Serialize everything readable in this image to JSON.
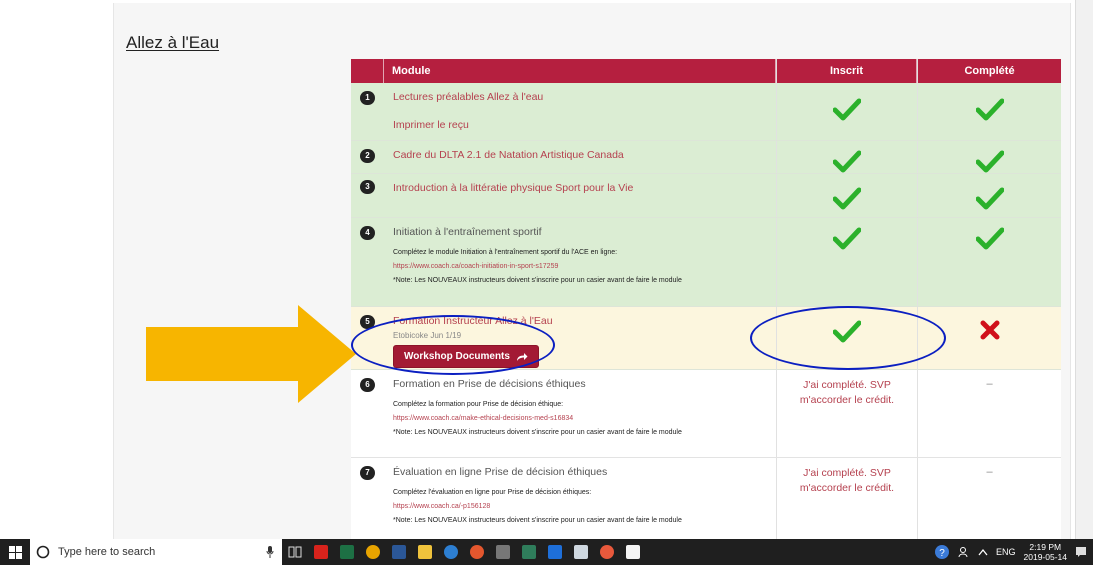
{
  "page": {
    "title": "Allez à l'Eau"
  },
  "table": {
    "headers": {
      "module": "Module",
      "enrolled": "Inscrit",
      "completed": "Complété"
    },
    "rows": [
      {
        "num": "1",
        "title": "Lectures préalables Allez à l'eau",
        "extra_link": "Imprimer le reçu",
        "enrolled": "check",
        "completed": "check"
      },
      {
        "num": "2",
        "title": "Cadre du DLTA 2.1 de Natation Artistique Canada",
        "enrolled": "check",
        "completed": "check"
      },
      {
        "num": "3",
        "title": "Introduction à la littératie physique Sport pour la Vie",
        "enrolled": "check",
        "completed": "check"
      },
      {
        "num": "4",
        "title": "Initiation à l'entraînement sportif",
        "note_intro": "Complétez le module Initiation à l'entraînement sportif du l'ACE en ligne:",
        "note_link": "https://www.coach.ca/coach-initiation-in-sport-s17259",
        "note_warn": "*Note: Les NOUVEAUX instructeurs doivent s'inscrire pour un casier avant de faire le module",
        "enrolled": "check",
        "completed": "check"
      },
      {
        "num": "5",
        "title": "Formation Instructeur Allez à l'Eau",
        "subtitle": "Etobicoke Jun 1/19",
        "button": "Workshop Documents",
        "enrolled": "check",
        "completed": "cross"
      },
      {
        "num": "6",
        "title": "Formation en Prise de décisions éthiques",
        "note_intro": "Complétez la formation pour Prise de décision éthique:",
        "note_link": "https://www.coach.ca/make-ethical-decisions-med-s16834",
        "note_warn": "*Note: Les NOUVEAUX instructeurs doivent s'inscrire pour un casier avant de faire le module",
        "enrolled_text": "J'ai complété. SVP m'accorder le crédit.",
        "completed_text": "–"
      },
      {
        "num": "7",
        "title": "Évaluation en ligne Prise de décision éthiques",
        "note_intro": "Complétez l'évaluation en ligne pour Prise de décision éthiques:",
        "note_link": "https://www.coach.ca/-p156128",
        "note_warn": "*Note: Les NOUVEAUX instructeurs doivent s'inscrire pour un casier avant de faire le module",
        "enrolled_text": "J'ai complété. SVP m'accorder le crédit.",
        "completed_text": "–"
      }
    ]
  },
  "colors": {
    "header": "#b51f3f",
    "check": "#2bb12b",
    "cross": "#d0101a",
    "arrow": "#f7b500",
    "ring": "#0b1fc1"
  },
  "taskbar": {
    "search_placeholder": "Type here to search",
    "language": "ENG",
    "time": "2:19 PM",
    "date": "2019-05-14"
  }
}
